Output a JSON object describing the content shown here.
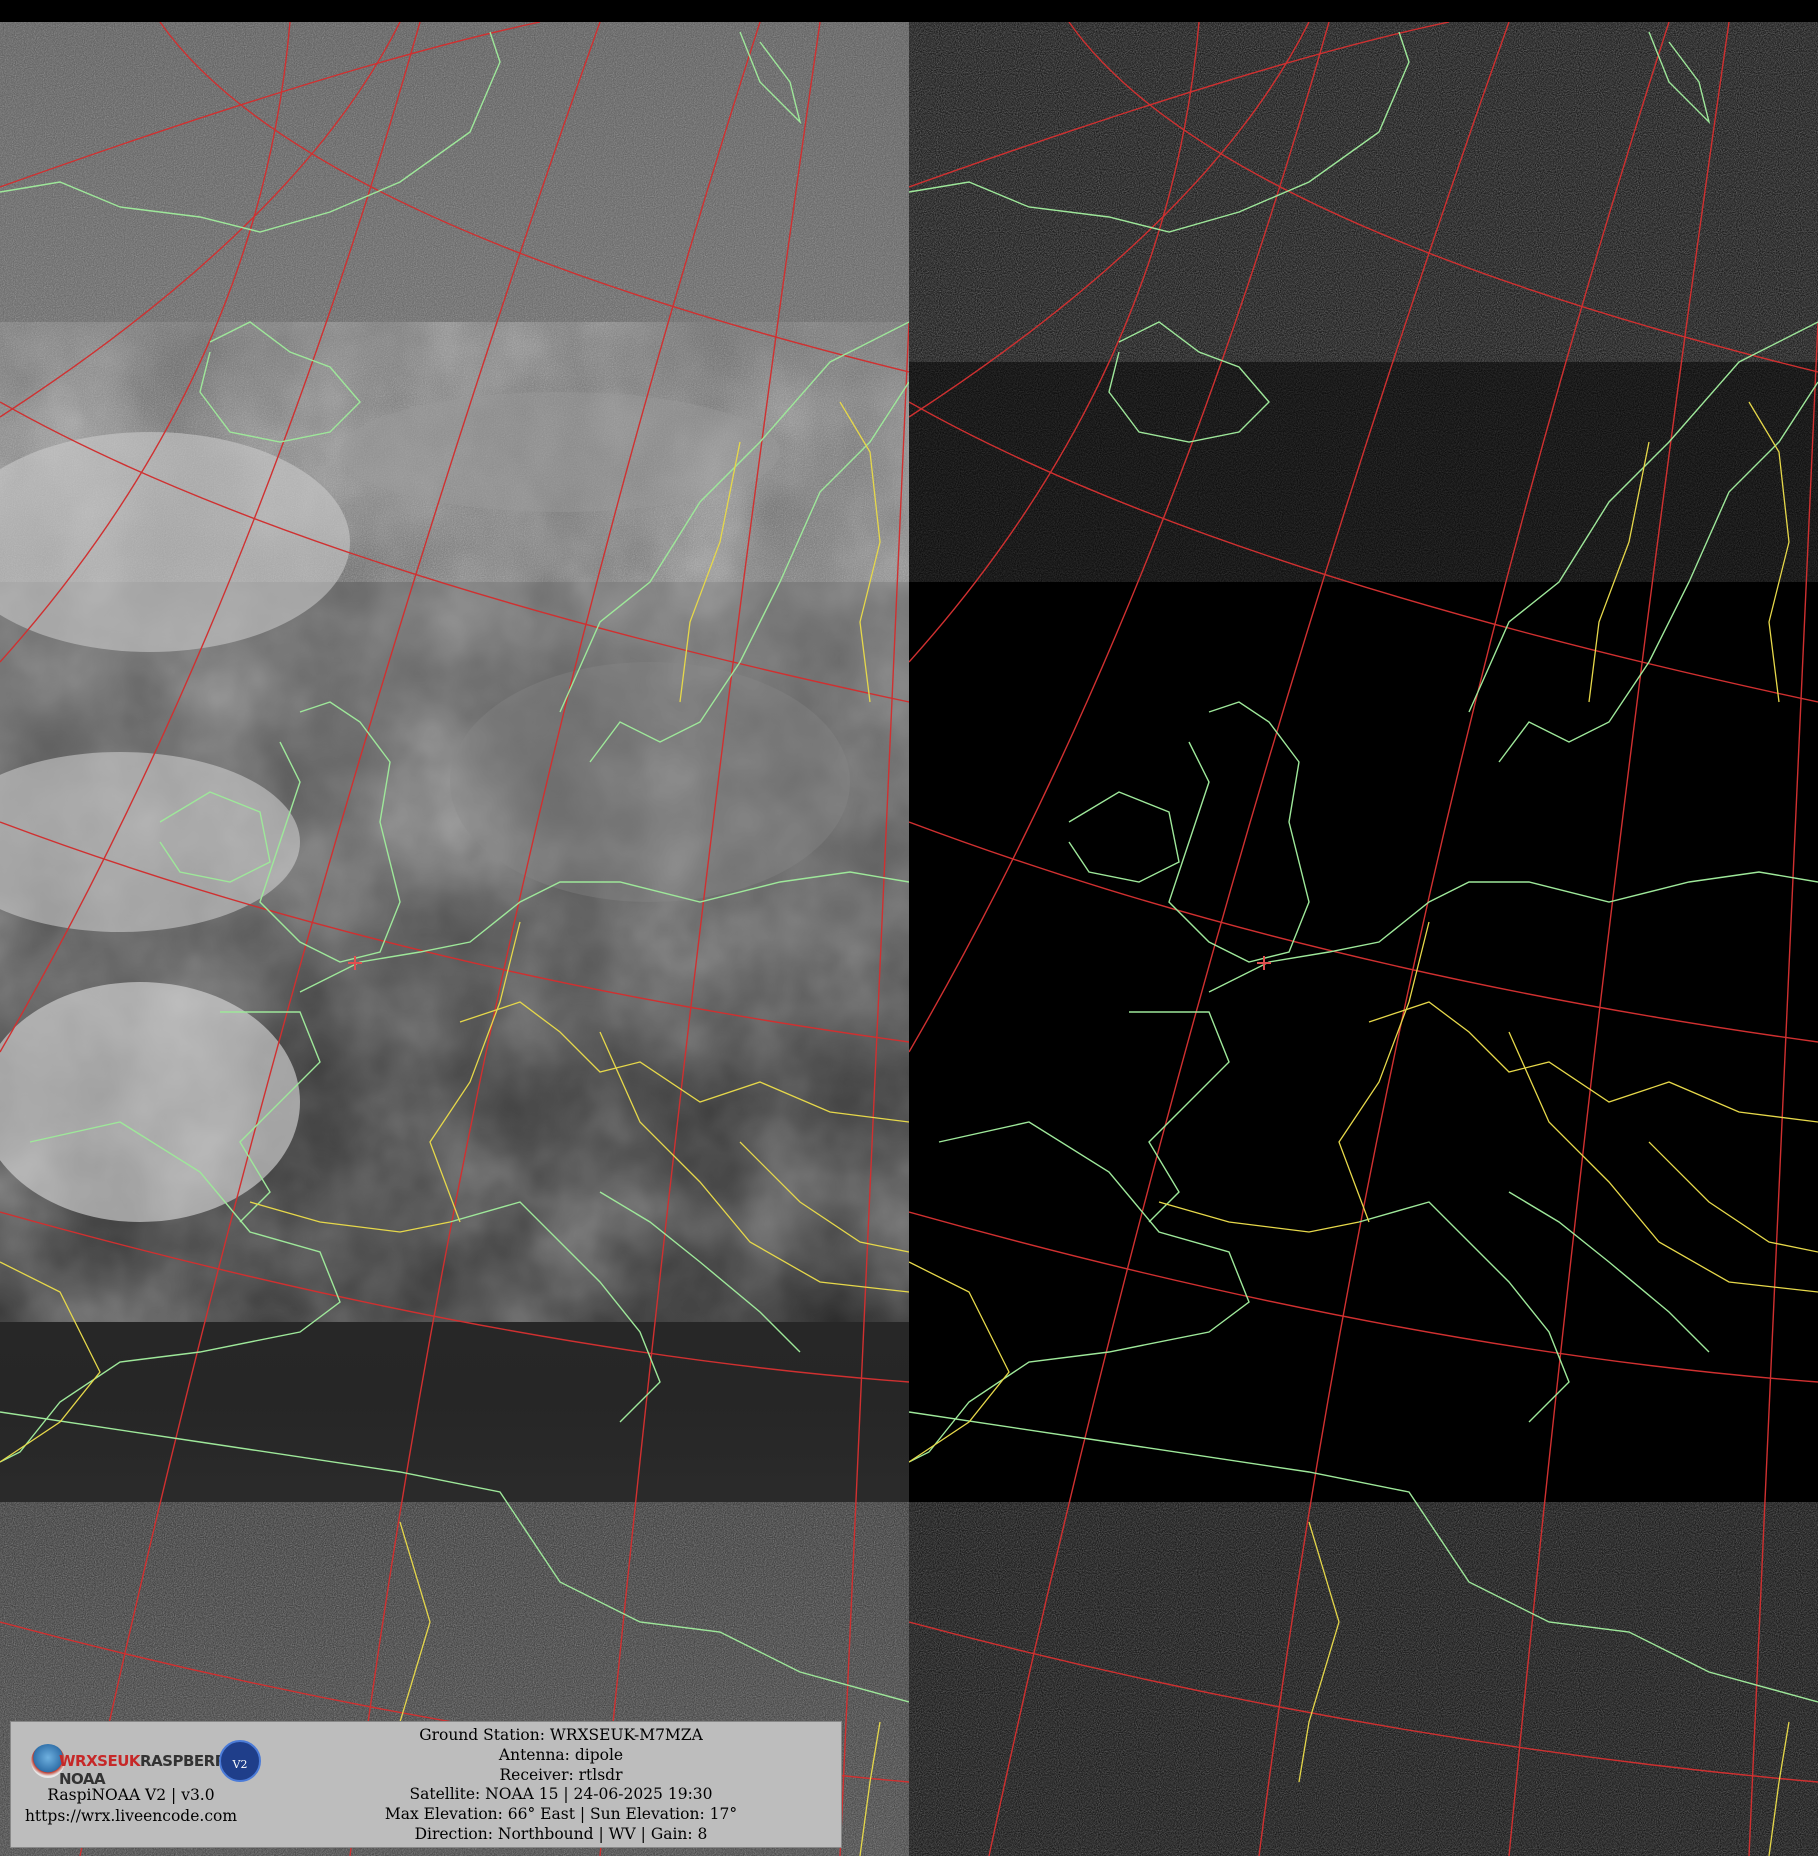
{
  "overlay": {
    "logo_text_1": "WRXSEUK",
    "logo_text_2": "RASPBERRY-NOAA",
    "logo_badge": "V2",
    "app_version": "RaspiNOAA V2 | v3.0",
    "app_url": "https://wrx.liveencode.com",
    "ground_station": "Ground Station: WRXSEUK-M7MZA",
    "antenna": "Antenna: dipole",
    "receiver": "Receiver: rtlsdr",
    "satellite": "Satellite: NOAA 15 | 24-06-2025 19:30",
    "elevation": "Max Elevation: 66° East | Sun Elevation: 17°",
    "direction": "Direction: Northbound | WV | Gain: 8"
  },
  "colors": {
    "graticule": "#d03030",
    "coastline": "#9ee89a",
    "border": "#e6d84a",
    "overlay_bg": "#bdbdbd"
  },
  "icons": {
    "logo": "raspberry-noaa-logo-icon",
    "satellite": "satellite-icon",
    "station_marker": "station-marker-icon"
  }
}
